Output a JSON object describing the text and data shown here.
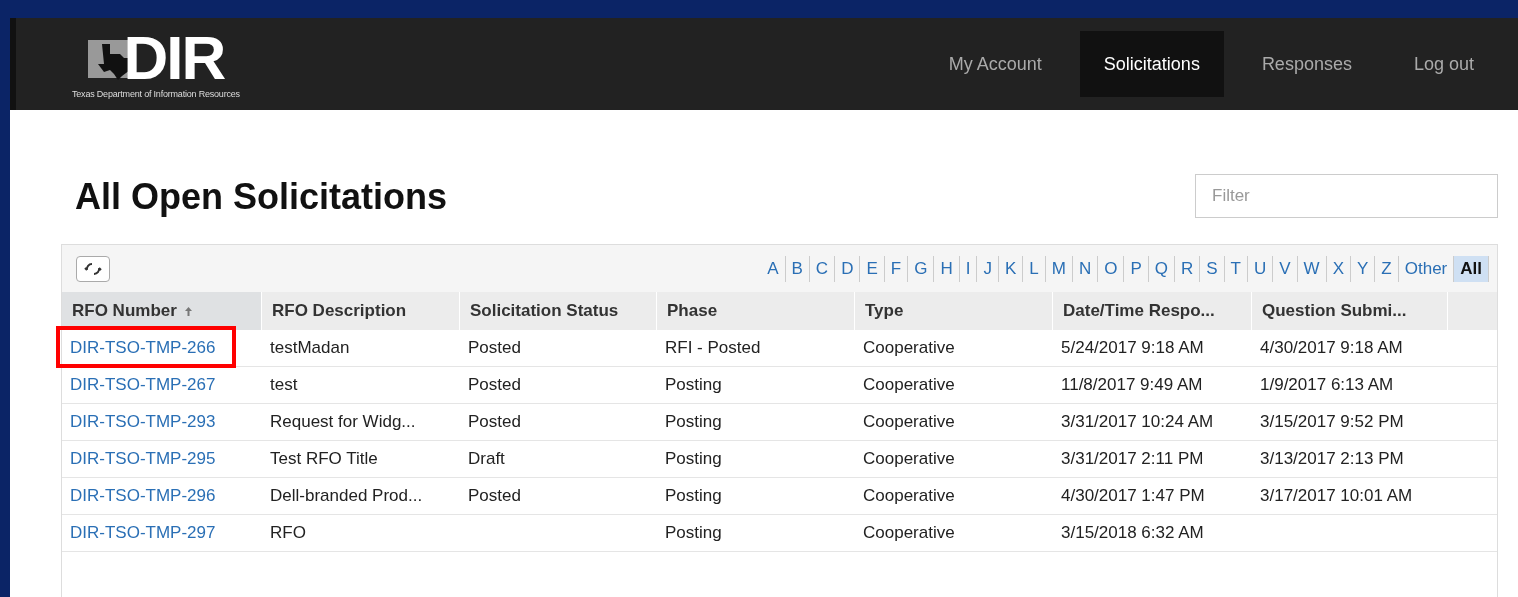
{
  "logo": {
    "mark": "DIR",
    "subtitle": "Texas Department of Information Resources"
  },
  "nav": [
    {
      "label": "My Account",
      "selected": false
    },
    {
      "label": "Solicitations",
      "selected": true
    },
    {
      "label": "Responses",
      "selected": false
    },
    {
      "label": "Log out",
      "selected": false
    }
  ],
  "page_title": "All Open Solicitations",
  "filter": {
    "placeholder": "Filter"
  },
  "letters": [
    {
      "label": "A",
      "selected": false
    },
    {
      "label": "B",
      "selected": false
    },
    {
      "label": "C",
      "selected": false
    },
    {
      "label": "D",
      "selected": false
    },
    {
      "label": "E",
      "selected": false
    },
    {
      "label": "F",
      "selected": false
    },
    {
      "label": "G",
      "selected": false
    },
    {
      "label": "H",
      "selected": false
    },
    {
      "label": "I",
      "selected": false
    },
    {
      "label": "J",
      "selected": false
    },
    {
      "label": "K",
      "selected": false
    },
    {
      "label": "L",
      "selected": false
    },
    {
      "label": "M",
      "selected": false
    },
    {
      "label": "N",
      "selected": false
    },
    {
      "label": "O",
      "selected": false
    },
    {
      "label": "P",
      "selected": false
    },
    {
      "label": "Q",
      "selected": false
    },
    {
      "label": "R",
      "selected": false
    },
    {
      "label": "S",
      "selected": false
    },
    {
      "label": "T",
      "selected": false
    },
    {
      "label": "U",
      "selected": false
    },
    {
      "label": "V",
      "selected": false
    },
    {
      "label": "W",
      "selected": false
    },
    {
      "label": "X",
      "selected": false
    },
    {
      "label": "Y",
      "selected": false
    },
    {
      "label": "Z",
      "selected": false
    },
    {
      "label": "Other",
      "selected": false
    },
    {
      "label": "All",
      "selected": true
    }
  ],
  "table": {
    "columns": [
      {
        "label": "RFO Number",
        "sorted": true
      },
      {
        "label": "RFO Description",
        "sorted": false
      },
      {
        "label": "Solicitation Status",
        "sorted": false
      },
      {
        "label": "Phase",
        "sorted": false
      },
      {
        "label": "Type",
        "sorted": false
      },
      {
        "label": "Date/Time Respo...",
        "sorted": false
      },
      {
        "label": "Question Submi...",
        "sorted": false
      }
    ],
    "rows": [
      {
        "highlighted": true,
        "cells": [
          "DIR-TSO-TMP-266",
          "testMadan",
          "Posted",
          "RFI - Posted",
          "Cooperative",
          "5/24/2017 9:18 AM",
          "4/30/2017 9:18 AM"
        ]
      },
      {
        "highlighted": false,
        "cells": [
          "DIR-TSO-TMP-267",
          "test",
          "Posted",
          "Posting",
          "Cooperative",
          "11/8/2017 9:49 AM",
          "1/9/2017 6:13 AM"
        ]
      },
      {
        "highlighted": false,
        "cells": [
          "DIR-TSO-TMP-293",
          "Request for Widg...",
          "Posted",
          "Posting",
          "Cooperative",
          "3/31/2017 10:24 AM",
          "3/15/2017 9:52 PM"
        ]
      },
      {
        "highlighted": false,
        "cells": [
          "DIR-TSO-TMP-295",
          "Test RFO Title",
          "Draft",
          "Posting",
          "Cooperative",
          "3/31/2017 2:11 PM",
          "3/13/2017 2:13 PM"
        ]
      },
      {
        "highlighted": false,
        "cells": [
          "DIR-TSO-TMP-296",
          "Dell-branded Prod...",
          "Posted",
          "Posting",
          "Cooperative",
          "4/30/2017 1:47 PM",
          "3/17/2017 10:01 AM"
        ]
      },
      {
        "highlighted": false,
        "cells": [
          "DIR-TSO-TMP-297",
          "RFO",
          "",
          "Posting",
          "Cooperative",
          "3/15/2018 6:32 AM",
          ""
        ]
      }
    ]
  }
}
